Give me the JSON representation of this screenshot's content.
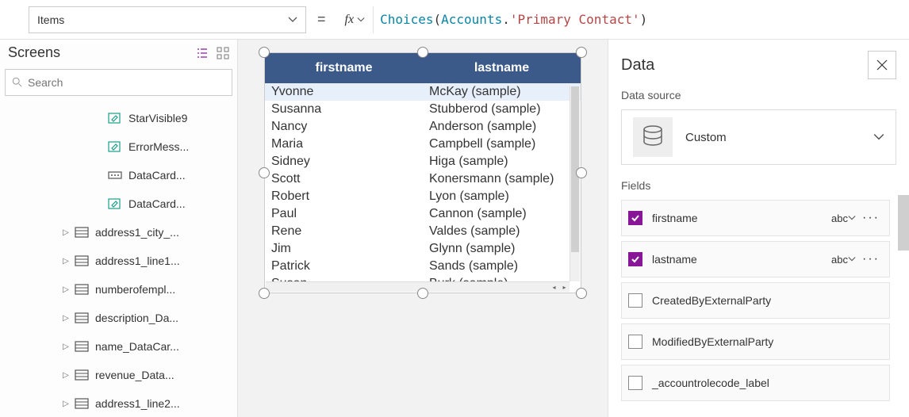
{
  "formula_bar": {
    "property": "Items",
    "equals": "=",
    "fx_label": "fx",
    "formula_tokens": {
      "fn": "Choices",
      "open": "( ",
      "ent": "Accounts",
      "dot": ".",
      "str": "'Primary Contact'",
      "close": " )"
    }
  },
  "left_panel": {
    "title": "Screens",
    "search_placeholder": "Search",
    "tree": [
      {
        "indent": "indent2",
        "icon": "edit",
        "label": "StarVisible9",
        "caret": ""
      },
      {
        "indent": "indent2",
        "icon": "edit",
        "label": "ErrorMess...",
        "caret": ""
      },
      {
        "indent": "indent2",
        "icon": "card",
        "label": "DataCard...",
        "caret": ""
      },
      {
        "indent": "indent2",
        "icon": "edit",
        "label": "DataCard...",
        "caret": ""
      },
      {
        "indent": "indent1",
        "icon": "form",
        "label": "address1_city_...",
        "caret": "▷"
      },
      {
        "indent": "indent1",
        "icon": "form",
        "label": "address1_line1...",
        "caret": "▷"
      },
      {
        "indent": "indent1",
        "icon": "form",
        "label": "numberofempl...",
        "caret": "▷"
      },
      {
        "indent": "indent1",
        "icon": "form",
        "label": "description_Da...",
        "caret": "▷"
      },
      {
        "indent": "indent1",
        "icon": "form",
        "label": "name_DataCar...",
        "caret": "▷"
      },
      {
        "indent": "indent1",
        "icon": "form",
        "label": "revenue_Data...",
        "caret": "▷"
      },
      {
        "indent": "indent1",
        "icon": "form",
        "label": "address1_line2...",
        "caret": "▷"
      }
    ]
  },
  "datatable": {
    "headers": [
      "firstname",
      "lastname"
    ],
    "rows": [
      [
        "Yvonne",
        "McKay (sample)"
      ],
      [
        "Susanna",
        "Stubberod (sample)"
      ],
      [
        "Nancy",
        "Anderson (sample)"
      ],
      [
        "Maria",
        "Campbell (sample)"
      ],
      [
        "Sidney",
        "Higa (sample)"
      ],
      [
        "Scott",
        "Konersmann (sample)"
      ],
      [
        "Robert",
        "Lyon (sample)"
      ],
      [
        "Paul",
        "Cannon (sample)"
      ],
      [
        "Rene",
        "Valdes (sample)"
      ],
      [
        "Jim",
        "Glynn (sample)"
      ],
      [
        "Patrick",
        "Sands (sample)"
      ],
      [
        "Susan",
        "Burk (sample)"
      ]
    ]
  },
  "right_panel": {
    "title": "Data",
    "data_source_label": "Data source",
    "data_source_name": "Custom",
    "fields_label": "Fields",
    "fields": [
      {
        "checked": true,
        "name": "firstname",
        "type": "abc"
      },
      {
        "checked": true,
        "name": "lastname",
        "type": "abc"
      },
      {
        "checked": false,
        "name": "CreatedByExternalParty",
        "type": ""
      },
      {
        "checked": false,
        "name": "ModifiedByExternalParty",
        "type": ""
      },
      {
        "checked": false,
        "name": "_accountrolecode_label",
        "type": ""
      }
    ]
  }
}
